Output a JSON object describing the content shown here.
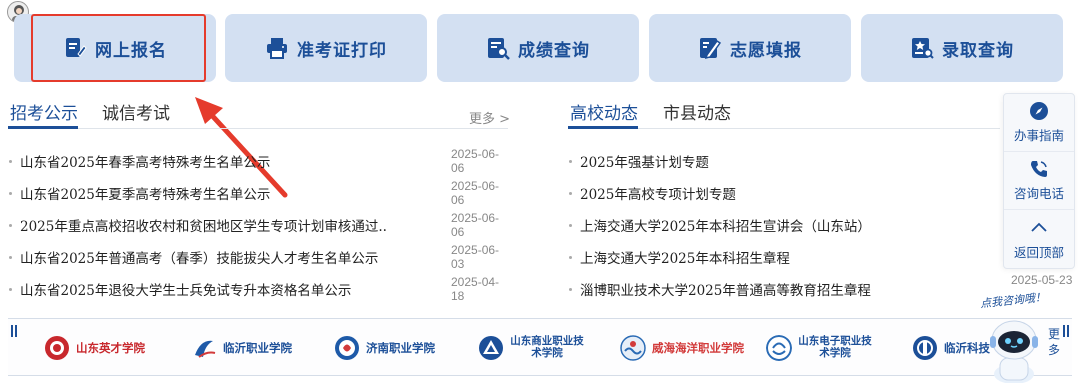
{
  "quick_buttons": [
    {
      "label": "网上报名",
      "icon": "edit-document-icon"
    },
    {
      "label": "准考证打印",
      "icon": "printer-icon"
    },
    {
      "label": "成绩查询",
      "icon": "search-document-icon"
    },
    {
      "label": "志愿填报",
      "icon": "form-pen-icon"
    },
    {
      "label": "录取查询",
      "icon": "notice-search-icon"
    }
  ],
  "left_section": {
    "tabs": [
      "招考公示",
      "诚信考试"
    ],
    "more": "更多 >",
    "items": [
      {
        "title": "山东省2025年春季高考特殊考生名单公示",
        "date": "2025-06-06"
      },
      {
        "title": "山东省2025年夏季高考特殊考生名单公示",
        "date": "2025-06-06"
      },
      {
        "title": "2025年重点高校招收农村和贫困地区学生专项计划审核通过..",
        "date": "2025-06-06"
      },
      {
        "title": "山东省2025年普通高考（春季）技能拔尖人才考生名单公示",
        "date": "2025-06-03"
      },
      {
        "title": "山东省2025年退役大学生士兵免试专升本资格名单公示",
        "date": "2025-04-18"
      }
    ]
  },
  "right_section": {
    "tabs": [
      "高校动态",
      "市县动态"
    ],
    "items": [
      {
        "title": "2025年强基计划专题",
        "date": ""
      },
      {
        "title": "2025年高校专项计划专题",
        "date": ""
      },
      {
        "title": "上海交通大学2025年本科招生宣讲会（山东站）",
        "date": ""
      },
      {
        "title": "上海交通大学2025年本科招生章程",
        "date": ""
      },
      {
        "title": "淄博职业技术大学2025年普通高等教育招生章程",
        "date": "2025-05-23"
      }
    ]
  },
  "side_panel": [
    {
      "label": "办事指南",
      "icon": "compass-icon"
    },
    {
      "label": "咨询电话",
      "icon": "phone-icon"
    },
    {
      "label": "返回顶部",
      "icon": "chevron-up-icon"
    }
  ],
  "banner": {
    "schools": [
      {
        "name": "山东英才学院",
        "color": "#c8282d"
      },
      {
        "name": "临沂职业学院",
        "color": "#1e5aa8"
      },
      {
        "name": "济南职业学院",
        "color": "#1e5aa8"
      },
      {
        "name": "山东商业职业技术学院",
        "color": "#1c4f98"
      },
      {
        "name": "威海海洋职业学院",
        "color": "#d23a3a"
      },
      {
        "name": "山东电子职业技术学院",
        "color": "#2a6bb5"
      },
      {
        "name": "临沂科技",
        "color": "#1c4f98"
      }
    ],
    "more": "更多"
  },
  "assistant": {
    "bubble": "点我咨询哦！"
  },
  "colors": {
    "accent": "#1c4f98",
    "button_bg": "#d3e0f2",
    "highlight": "#e53b2c"
  }
}
